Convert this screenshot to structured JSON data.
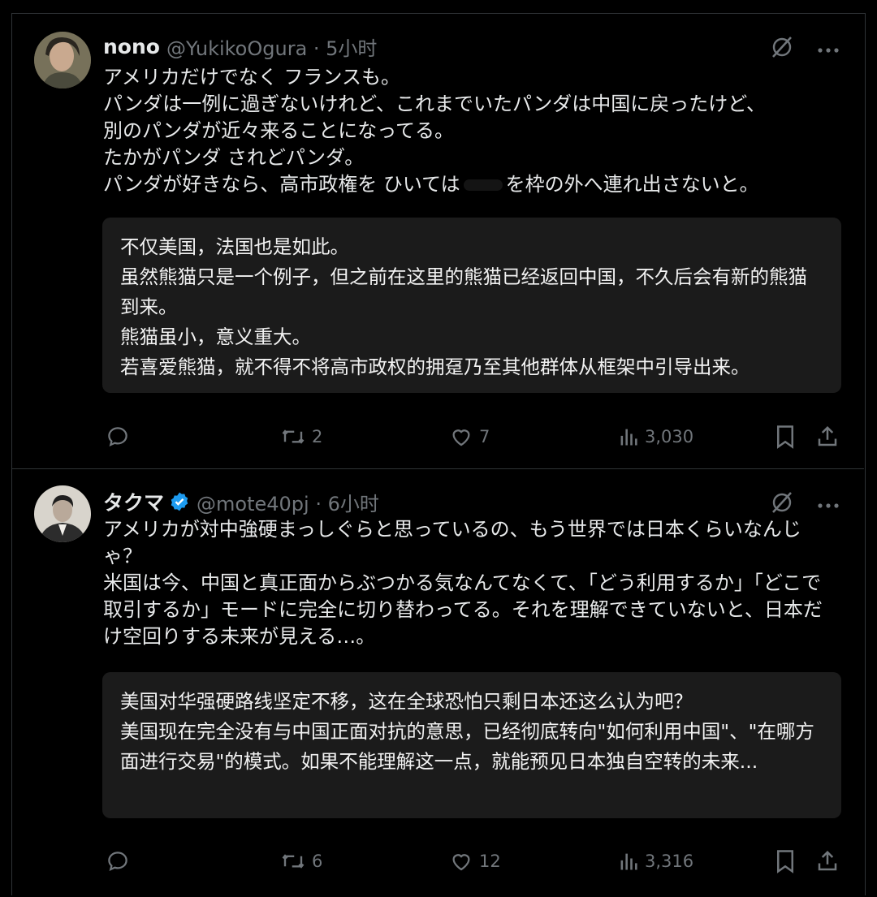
{
  "tweets": [
    {
      "name": "nono",
      "handle": "@YukikoOgura · 5小时",
      "body": "アメリカだけでなく フランスも。\nパンダは一例に過ぎないけれど、これまでいたパンダは中国に戻ったけど、\n別のパンダが近々来ることになってる。\nたかがパンダ されどパンダ。\nパンダが好きなら、高市政権を ひいては",
      "body_tail": "を枠の外へ連れ出さないと。",
      "translation": "不仅美国，法国也是如此。\n虽然熊猫只是一个例子，但之前在这里的熊猫已经返回中国，不久后会有新的熊猫到来。\n熊猫虽小，意义重大。\n若喜爱熊猫，就不得不将高市政权的拥趸乃至其他群体从框架中引导出来。",
      "retweets": "2",
      "likes": "7",
      "views": "3,030"
    },
    {
      "name": "タクマ",
      "handle": "@mote40pj · 6小时",
      "body": "アメリカが対中強硬まっしぐらと思っているの、もう世界では日本くらいなんじゃ？\n米国は今、中国と真正面からぶつかる気なんてなくて、「どう利用するか」「どこで取引するか」モードに完全に切り替わってる。それを理解できていないと、日本だけ空回りする未来が見える…。",
      "translation": "美国对华强硬路线坚定不移，这在全球恐怕只剩日本还这么认为吧？\n美国现在完全没有与中国正面对抗的意思，已经彻底转向\"如何利用中国\"、\"在哪方面进行交易\"的模式。如果不能理解这一点，就能预见日本独自空转的未来...",
      "retweets": "6",
      "likes": "12",
      "views": "3,316"
    }
  ],
  "colors": {
    "verified": "#1d9bf0",
    "muted": "#71767b",
    "text": "#e7e9ea",
    "translation_bg": "#1b1b1b"
  },
  "icons": [
    "grok-icon",
    "more-icon",
    "reply-icon",
    "retweet-icon",
    "like-icon",
    "views-icon",
    "bookmark-icon",
    "share-icon",
    "verified-badge-icon"
  ]
}
